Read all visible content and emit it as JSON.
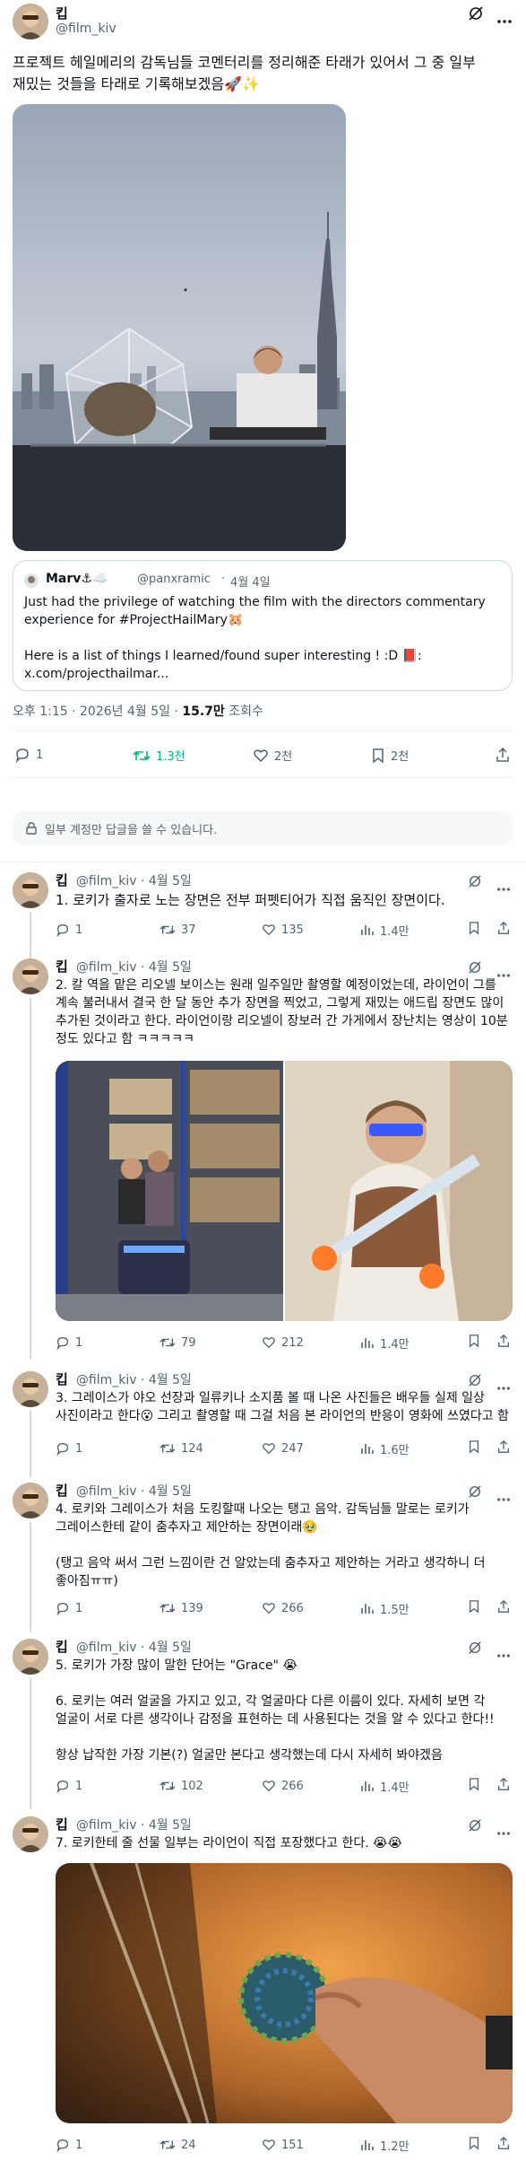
{
  "main": {
    "name": "킵",
    "handle": "@film_kiv",
    "text": "프로젝트 헤일메리의 감독님들 코멘터리를 정리해준 타래가 있어서 그 중 일부 재밌는 것들을 타래로 기록해보겠음🚀✨",
    "quote": {
      "name": "Marv⚓☁️",
      "handle": "@panxramic",
      "date": "4월 4일",
      "text": "Just had the privilege of watching the film with the directors commentary experience for #ProjectHailMary🐹\n\nHere is a list of things I learned/found super interesting ! :D 📕:\nx.com/projecthailmar..."
    },
    "meta": {
      "time": "오후 1:15 · 2026년 4월 5일 · ",
      "views": "15.7만",
      "views_label": " 조회수"
    },
    "stats": {
      "reply": "1",
      "retweet": "1.3천",
      "like": "2천",
      "bookmark": "2천"
    },
    "reply_restriction": "일부 계정만 답글을 쓸 수 있습니다."
  },
  "replies": [
    {
      "name": "킵",
      "handle": "@film_kiv · 4월 5일",
      "text": "1. 로키가 출자로 노는 장면은 전부 퍼펫티어가 직접 움직인 장면이다.",
      "stats": {
        "reply": "1",
        "retweet": "37",
        "like": "135",
        "views": "1.4만"
      }
    },
    {
      "name": "킵",
      "handle": "@film_kiv · 4월 5일",
      "text": "2. 칼 역을 맡은 리오넬 보이스는 원래 일주일만 촬영할 예정이었는데, 라이언이 그를 계속 불러내서 결국 한 달 동안 추가 장면을 찍었고, 그렇게 재밌는 애드립 장면도 많이 추가된 것이라고 한다. 라이언이랑 리오넬이 장보러 간 가게에서 장난치는 영상이 10분 정도 있다고 함 ㅋㅋㅋㅋㅋ",
      "stats": {
        "reply": "1",
        "retweet": "79",
        "like": "212",
        "views": "1.4만"
      }
    },
    {
      "name": "킵",
      "handle": "@film_kiv · 4월 5일",
      "text": "3. 그레이스가 야오 선장과 일류키나 소지품 볼 때 나온 사진들은 배우들 실제 일상 사진이라고 한다😮 그리고 촬영할 때 그걸 처음 본 라이언의 반응이 영화에 쓰였다고 함",
      "stats": {
        "reply": "1",
        "retweet": "124",
        "like": "247",
        "views": "1.6만"
      }
    },
    {
      "name": "킵",
      "handle": "@film_kiv · 4월 5일",
      "text": "4. 로키와 그레이스가 처음 도킹할때 나오는 탱고 음악. 감독님들 말로는 로키가 그레이스한테 같이 춤추자고 제안하는 장면이래🥹\n\n(탱고 음악 써서 그런 느낌이란 건 알았는데 춤추자고 제안하는 거라고 생각하니 더 좋아짐ㅠㅠ)",
      "stats": {
        "reply": "1",
        "retweet": "139",
        "like": "266",
        "views": "1.5만"
      }
    },
    {
      "name": "킵",
      "handle": "@film_kiv · 4월 5일",
      "text": "5. 로키가 가장 많이 말한 단어는 \"Grace\" 😭\n\n6. 로키는 여러 얼굴을 가지고 있고, 각 얼굴마다 다른 이름이 있다. 자세히 보면 각 얼굴이 서로 다른 생각이나 감정을 표현하는 데 사용된다는 것을 알 수 있다고 한다!!\n\n항상 납작한 가장 기본(?) 얼굴만 본다고 생각했는데 다시 자세히 봐야겠음",
      "stats": {
        "reply": "1",
        "retweet": "102",
        "like": "266",
        "views": "1.4만"
      }
    },
    {
      "name": "킵",
      "handle": "@film_kiv · 4월 5일",
      "text": "7. 로키한테 줄 선물 일부는 라이언이 직접 포장했다고 한다. 😭😭",
      "stats": {
        "reply": "1",
        "retweet": "24",
        "like": "151",
        "views": "1.2만"
      }
    }
  ],
  "colors": {
    "text": "#0f1419",
    "muted": "#536471",
    "retweet": "#00ba7c",
    "border": "#cfd9de"
  }
}
